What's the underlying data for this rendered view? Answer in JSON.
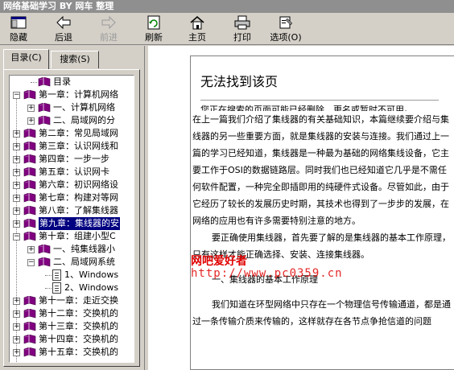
{
  "window": {
    "title": "网络基础学习 BY 网车 整理"
  },
  "toolbar": {
    "hide": {
      "label": "隐藏",
      "icon": "hide-icon"
    },
    "back": {
      "label": "后退",
      "icon": "back-arrow-icon"
    },
    "forward": {
      "label": "前进",
      "icon": "forward-arrow-icon"
    },
    "refresh": {
      "label": "刷新",
      "icon": "refresh-icon"
    },
    "home": {
      "label": "主页",
      "icon": "home-icon"
    },
    "print": {
      "label": "打印",
      "icon": "print-icon"
    },
    "options": {
      "label": "选项(O)",
      "icon": "options-icon"
    }
  },
  "tabs": {
    "contents": "目录(C)",
    "search": "搜索(S)"
  },
  "tree": {
    "items": [
      {
        "label": "目录",
        "type": "book"
      },
      {
        "label": "第一章：计算机网络",
        "type": "book",
        "exp": "-"
      },
      {
        "label": "一、计算机网络",
        "type": "book",
        "exp": "+"
      },
      {
        "label": "二、局域网的分",
        "type": "book",
        "exp": "+"
      },
      {
        "label": "第二章：常见局域网",
        "type": "book",
        "exp": "+"
      },
      {
        "label": "第三章：认识网线和",
        "type": "book",
        "exp": "+"
      },
      {
        "label": "第四章：一步一步",
        "type": "book",
        "exp": "+"
      },
      {
        "label": "第五章：认识网卡",
        "type": "book",
        "exp": "+"
      },
      {
        "label": "第六章：初识网络设",
        "type": "book",
        "exp": "+"
      },
      {
        "label": "第七章：构建对等网",
        "type": "book",
        "exp": "+"
      },
      {
        "label": "第八章：了解集线器",
        "type": "book",
        "exp": "+"
      },
      {
        "label": "第九章：集线器的安",
        "type": "book",
        "exp": "+",
        "selected": true
      },
      {
        "label": "第十章：组建小型C",
        "type": "book",
        "exp": "-"
      },
      {
        "label": "一、纯集线器小",
        "type": "book",
        "exp": "+"
      },
      {
        "label": "二、局域网系统",
        "type": "book",
        "exp": "-"
      },
      {
        "label": "1、Windows",
        "type": "doc"
      },
      {
        "label": "2、Windows",
        "type": "doc"
      },
      {
        "label": "第十一章：走近交换",
        "type": "book",
        "exp": "+"
      },
      {
        "label": "第十二章：交换机的",
        "type": "book",
        "exp": "+"
      },
      {
        "label": "第十三章：交换机的",
        "type": "book",
        "exp": "+"
      },
      {
        "label": "第十四章：交换机的",
        "type": "book",
        "exp": "+"
      },
      {
        "label": "第十五章：交换机的",
        "type": "book",
        "exp": "+"
      }
    ]
  },
  "page": {
    "notfound_title": "无法找到该页",
    "notfound_sub": "您正在搜索的页面可能已经删除、更名或暂时不可用。",
    "para1": "在上一篇我们介绍了集线器的有关基础知识，本篇继续要介绍与集线器的另一些重要方面，就是集线器的安装与连接。我们通过上一篇的学习已经知道，集线器是一种最为基础的网络集线设备，它主要工作于OSI的数据链路层。同时我们也已经知道它几乎是不需任何软件配置，一种完全即插即用的纯硬件式设备。尽管如此，由于它经历了较长的发展历史时期，其技术也得到了一步步的发展，在网络的应用也有许多需要特别注意的地方。",
    "para2": "要正确使用集线器，首先要了解的是集线器的基本工作原理，只有这样才能正确选择、安装、连接集线器。",
    "heading1": "一、集线器的基本工作原理",
    "para3": "我们知道在环型网络中只存在一个物理信号传输通道，都是通过一条传输介质来传输的，这样就存在各节点争抢信道的问题",
    "watermark_cn": "网吧爱好者",
    "watermark_url": "http://www.pc0359.cn"
  },
  "colors": {
    "selection": "#000080",
    "watermark": "#e00000",
    "titlebar": "#8f8f8f"
  }
}
